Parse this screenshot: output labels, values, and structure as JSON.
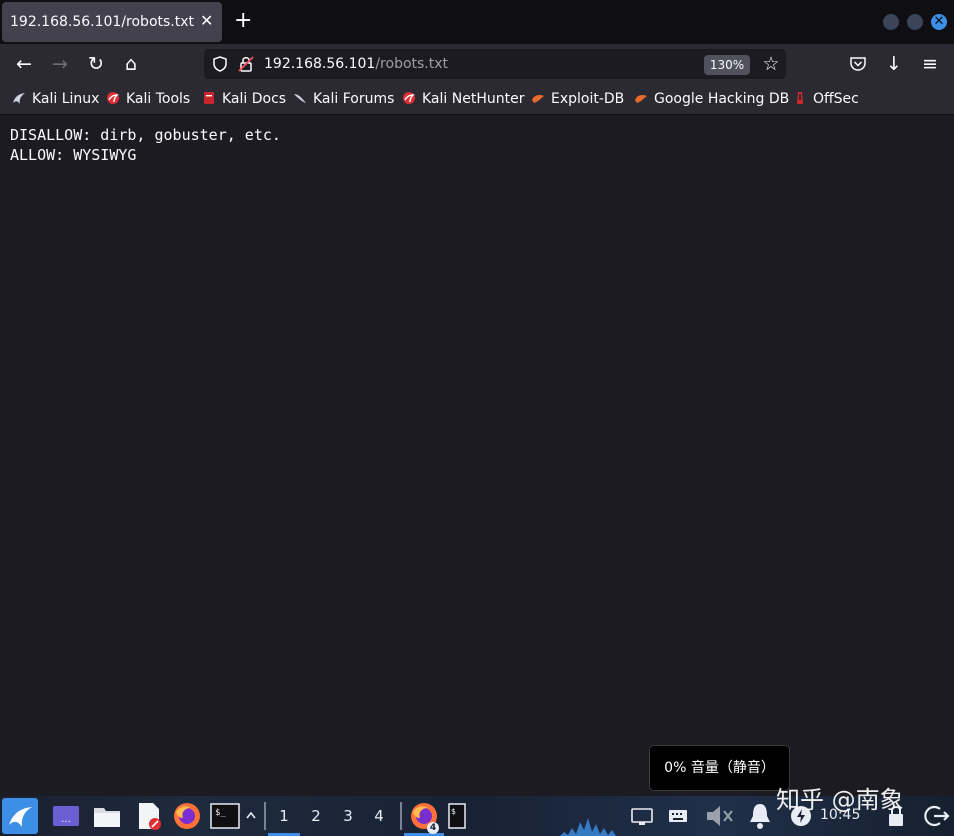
{
  "tab": {
    "title": "192.168.56.101/robots.txt",
    "close": "✕",
    "new_tab": "+"
  },
  "window": {
    "close": "✕"
  },
  "navbar": {
    "back": "←",
    "forward": "→",
    "reload": "↻",
    "home": "⌂",
    "url_host": "192.168.56.101",
    "url_path": "/robots.txt",
    "zoom": "130%",
    "bookmark_star": "☆",
    "downloads": "↓",
    "menu": "≡"
  },
  "bookmarks": [
    {
      "label": "Kali Linux",
      "icon": "kali-dragon-icon"
    },
    {
      "label": "Kali Tools",
      "icon": "kali-tools-icon"
    },
    {
      "label": "Kali Docs",
      "icon": "kali-docs-icon"
    },
    {
      "label": "Kali Forums",
      "icon": "kali-forums-icon"
    },
    {
      "label": "Kali NetHunter",
      "icon": "nethunter-icon"
    },
    {
      "label": "Exploit-DB",
      "icon": "exploit-db-icon"
    },
    {
      "label": "Google Hacking DB",
      "icon": "ghdb-icon"
    },
    {
      "label": "OffSec",
      "icon": "offsec-icon"
    }
  ],
  "page": {
    "lines": [
      "DISALLOW: dirb, gobuster, etc.",
      "ALLOW: WYSIWYG"
    ]
  },
  "osd": {
    "text": "0% 音量（静音）"
  },
  "watermark": {
    "text": "知乎 @南象"
  },
  "taskbar": {
    "workspaces": [
      "1",
      "2",
      "3",
      "4"
    ],
    "firefox_window_count": "4",
    "clock": "10:45",
    "colors": {
      "kali_blue": "#3d8fe6",
      "firefox_orange": "#ff7139"
    }
  }
}
